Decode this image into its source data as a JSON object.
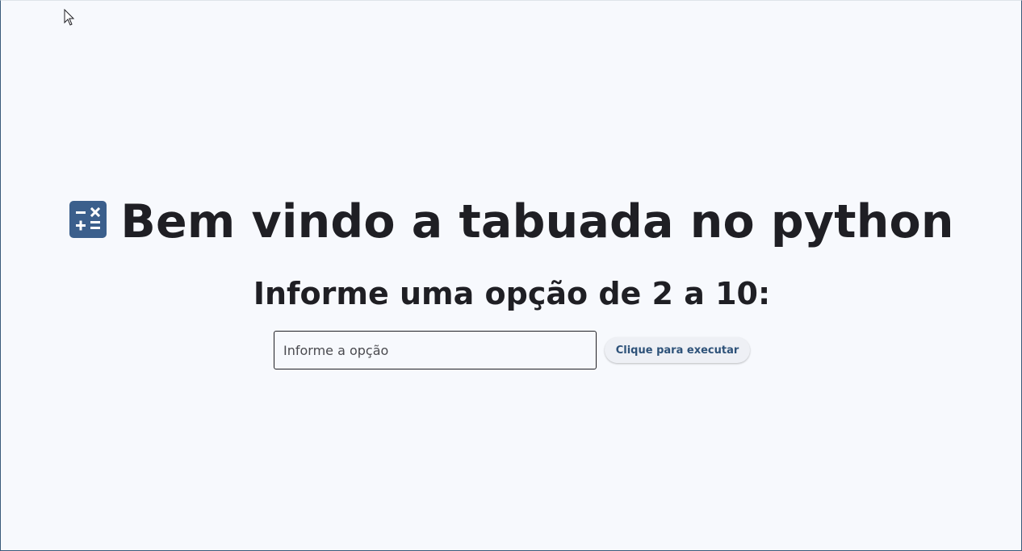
{
  "header": {
    "icon": "calculator-icon",
    "title": "Bem vindo a tabuada no python"
  },
  "form": {
    "prompt": "Informe uma opção de 2 a 10:",
    "input_value": "",
    "input_placeholder": "Informe a opção",
    "button_label": "Clique para executar"
  },
  "colors": {
    "background": "#f7f9fd",
    "icon": "#3b5f8c",
    "text": "#1f1f24",
    "button_text": "#2e5279"
  }
}
